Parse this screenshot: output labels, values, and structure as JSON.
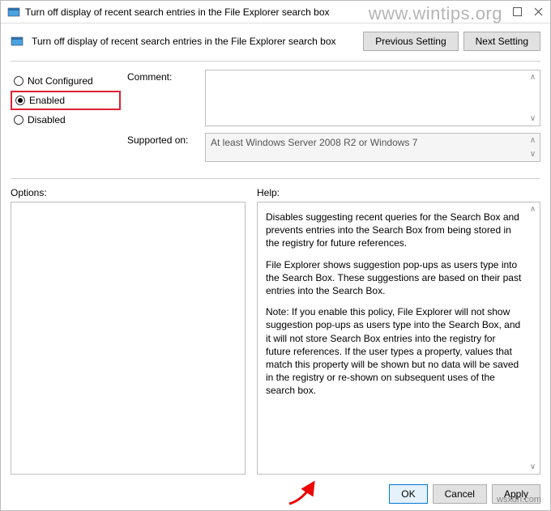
{
  "window": {
    "title": "Turn off display of recent search entries in the File Explorer search box"
  },
  "header": {
    "label": "Turn off display of recent search entries in the File Explorer search box",
    "prev": "Previous Setting",
    "next": "Next Setting"
  },
  "radios": {
    "not_configured": "Not Configured",
    "enabled": "Enabled",
    "disabled": "Disabled",
    "selected": "enabled"
  },
  "fields": {
    "comment_label": "Comment:",
    "comment_value": "",
    "supported_label": "Supported on:",
    "supported_value": "At least Windows Server 2008 R2 or Windows 7"
  },
  "panels": {
    "options_label": "Options:",
    "help_label": "Help:",
    "help_text_p1": "Disables suggesting recent queries for the Search Box and prevents entries into the Search Box from being stored in the registry for future references.",
    "help_text_p2": "File Explorer shows suggestion pop-ups as users type into the Search Box.  These suggestions are based on their past entries into the Search Box.",
    "help_text_p3": "Note: If you enable this policy, File Explorer will not show suggestion pop-ups as users type into the Search Box, and it will not store Search Box entries into the registry for future references.  If the user types a property, values that match this property will be shown but no data will be saved in the registry or re-shown on subsequent uses of the search box."
  },
  "buttons": {
    "ok": "OK",
    "cancel": "Cancel",
    "apply": "Apply"
  },
  "watermark": "www.wintips.org",
  "watermark2": "wsxdn.com"
}
